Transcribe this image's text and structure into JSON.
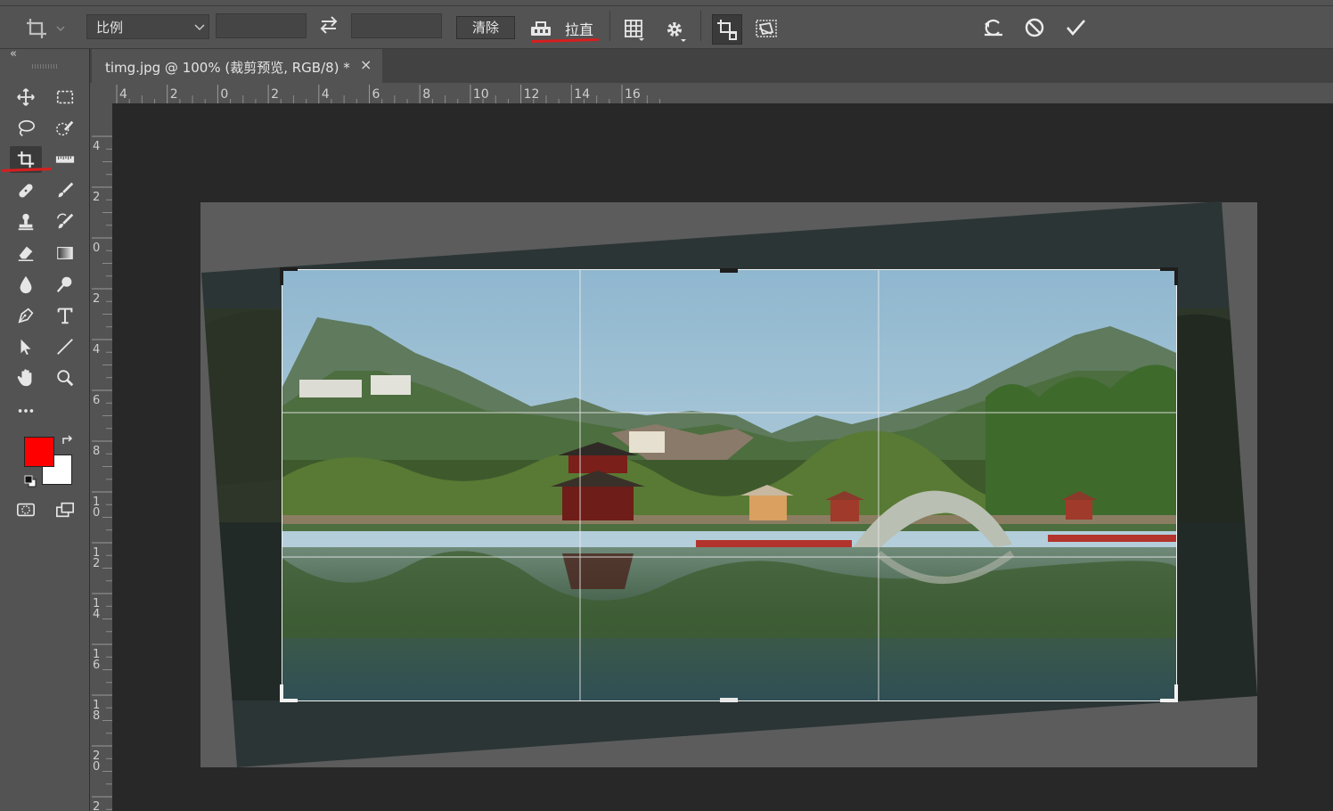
{
  "options_bar": {
    "ratio_select": "比例",
    "width_value": "",
    "height_value": "",
    "clear_label": "清除",
    "straighten_label": "拉直"
  },
  "document": {
    "tab_title": "timg.jpg @ 100% (裁剪预览, RGB/8) *",
    "close_glyph": "×"
  },
  "panel": {
    "collapse_glyph": "«"
  },
  "rulers": {
    "horizontal": [
      "4",
      "2",
      "0",
      "2",
      "4",
      "6",
      "8",
      "10",
      "12",
      "14",
      "16"
    ],
    "vertical": [
      "4",
      "2",
      "0",
      "2",
      "4",
      "6",
      "8",
      "1\n0",
      "1\n2",
      "1\n4",
      "1\n6",
      "1\n8",
      "2\n0",
      "2"
    ]
  },
  "colors": {
    "foreground": "#ff0000",
    "background": "#ffffff",
    "ui_background": "#535353",
    "canvas_background": "#282828",
    "annotation_red": "#d81e1e"
  },
  "icons": [
    "crop-icon",
    "swap-icon",
    "straighten-icon",
    "grid-overlay-icon",
    "gear-icon",
    "delete-cropped-icon",
    "content-aware-icon",
    "reset-icon",
    "cancel-icon",
    "commit-icon",
    "move-icon",
    "marquee-icon",
    "lasso-icon",
    "quick-select-icon",
    "ruler-icon",
    "healing-brush-icon",
    "brush-icon",
    "stamp-icon",
    "history-brush-icon",
    "eraser-icon",
    "gradient-icon",
    "blur-icon",
    "dodge-icon",
    "pen-icon",
    "type-icon",
    "path-select-icon",
    "line-icon",
    "hand-icon",
    "zoom-icon",
    "more-icon",
    "quick-mask-icon",
    "screen-mode-icon"
  ]
}
